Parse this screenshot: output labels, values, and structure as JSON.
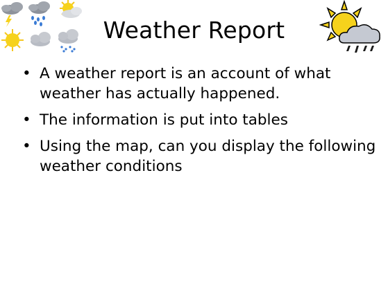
{
  "slide": {
    "title": "Weather Report",
    "bullet_glyph": "•",
    "bullets": [
      "A weather report is an account of what weather has actually happened.",
      "The information is put into tables",
      "Using the map, can you display the following weather conditions"
    ]
  },
  "icons": {
    "top_left_row1": [
      "storm-cloud-icon",
      "rain-cloud-icon",
      "sun-behind-cloud-icon"
    ],
    "top_left_row2": [
      "sun-icon",
      "cloud-icon",
      "snow-cloud-icon"
    ],
    "top_right": "sun-rain-cloud-icon"
  },
  "colors": {
    "text": "#000000",
    "background": "#ffffff",
    "sun": "#f6d21c",
    "cloud": "#b8bcc4",
    "rain": "#3a7bd5"
  }
}
